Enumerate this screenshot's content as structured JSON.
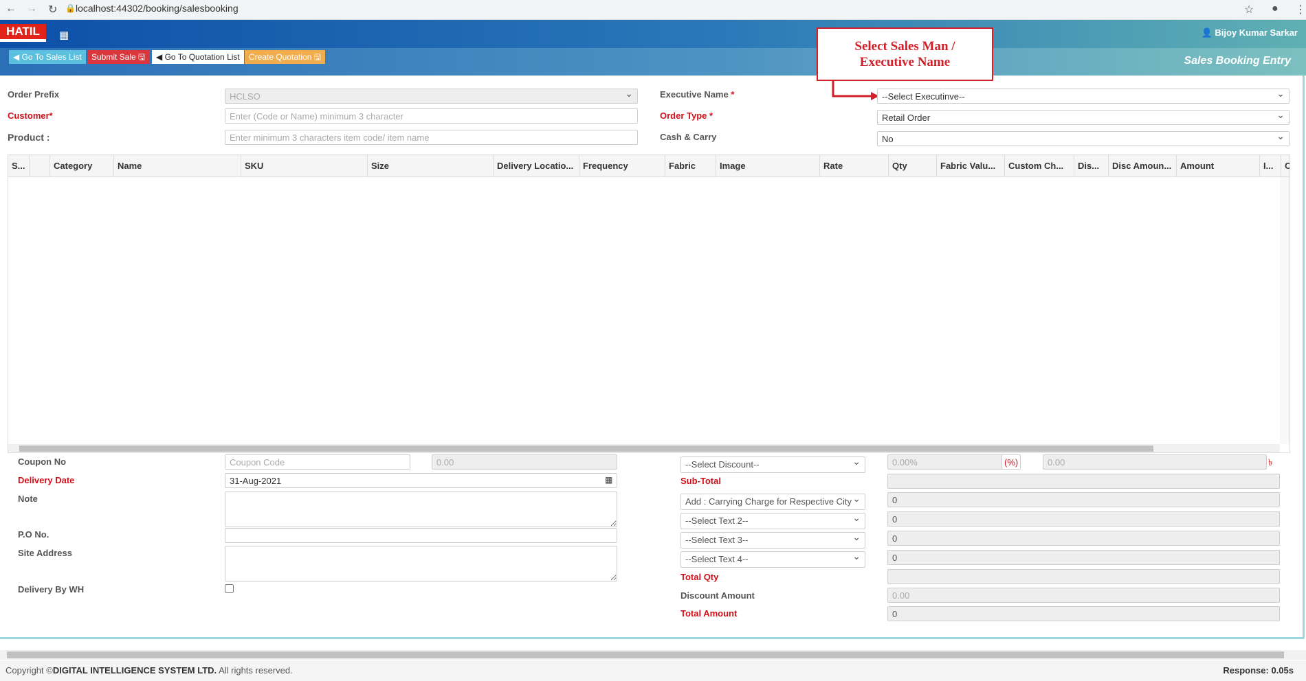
{
  "browser": {
    "url": "localhost:44302/booking/salesbooking"
  },
  "header": {
    "logo": "HATIL",
    "user": "Bijoy Kumar Sarkar",
    "page_title": "Sales Booking Entry",
    "buttons": {
      "sales_list": "Go To Sales List",
      "submit_sale": "Submit Sale",
      "quotation_list": "Go To Quotation List",
      "create_quotation": "Create Quotation"
    },
    "colors": {
      "sales_list": "#5bc0de",
      "submit_sale": "#d9363e",
      "create_quotation": "#f0ad4e"
    }
  },
  "annotation": {
    "text1": "Select Sales Man /",
    "text2": "Executive Name"
  },
  "form": {
    "order_prefix": {
      "label": "Order Prefix",
      "value": "HCLSO"
    },
    "customer": {
      "label": "Customer*",
      "placeholder": "Enter (Code or Name) minimum 3 character"
    },
    "product": {
      "label": "Product :",
      "placeholder": "Enter minimum 3 characters item code/ item name"
    },
    "executive": {
      "label": "Executive Name",
      "value": "--Select Executinve--"
    },
    "order_type": {
      "label": "Order Type",
      "value": "Retail Order"
    },
    "cash_carry": {
      "label": "Cash & Carry",
      "value": "No"
    }
  },
  "table": {
    "columns": [
      "S...",
      "",
      "Category",
      "Name",
      "SKU",
      "Size",
      "Delivery Locatio...",
      "Frequency",
      "Fabric",
      "Image",
      "Rate",
      "Qty",
      "Fabric Valu...",
      "Custom Ch...",
      "Dis...",
      "Disc Amoun...",
      "Amount",
      "I...",
      "C"
    ]
  },
  "bottom_left": {
    "coupon": {
      "label": "Coupon No",
      "placeholder": "Coupon Code",
      "amount": "0.00"
    },
    "delivery_date": {
      "label": "Delivery Date",
      "value": "31-Aug-2021"
    },
    "note": {
      "label": "Note"
    },
    "po": {
      "label": "P.O No."
    },
    "site_address": {
      "label": "Site Address"
    },
    "delivery_wh": {
      "label": "Delivery By WH",
      "checked": false
    }
  },
  "bottom_right": {
    "discount_select": "--Select Discount--",
    "discount_pct": "0.00%",
    "pct_sign": "(%)",
    "discount_value": "0.00",
    "currency": "৳",
    "subtotal_label": "Sub-Total",
    "carrying": {
      "select": "Add : Carrying Charge for Respective City",
      "value": "0"
    },
    "text2": {
      "select": "--Select Text 2--",
      "value": "0"
    },
    "text3": {
      "select": "--Select Text 3--",
      "value": "0"
    },
    "text4": {
      "select": "--Select Text 4--",
      "value": "0"
    },
    "total_qty_label": "Total Qty",
    "discount_amount": {
      "label": "Discount Amount",
      "value": "0.00"
    },
    "total_amount": {
      "label": "Total Amount",
      "value": "0"
    }
  },
  "footer": {
    "prefix": "Copyright ©",
    "company": "DIGITAL INTELLIGENCE SYSTEM LTD.",
    "suffix": " All rights reserved.",
    "response": "Response: 0.05s"
  }
}
